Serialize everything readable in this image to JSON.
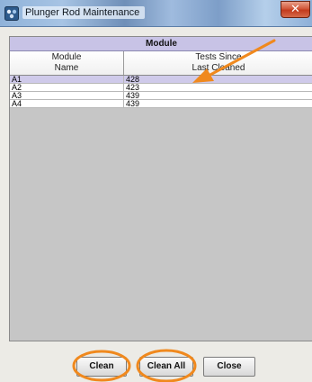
{
  "window": {
    "title": "Plunger Rod Maintenance",
    "close_glyph": "✕",
    "icon": "app-icon"
  },
  "table": {
    "group_header": "Module",
    "columns": [
      {
        "line1": "Module",
        "line2": "Name"
      },
      {
        "line1": "Tests Since",
        "line2": "Last Cleaned"
      }
    ],
    "rows": [
      {
        "name": "A1",
        "tests": "428",
        "selected": true
      },
      {
        "name": "A2",
        "tests": "423",
        "selected": false
      },
      {
        "name": "A3",
        "tests": "439",
        "selected": false
      },
      {
        "name": "A4",
        "tests": "439",
        "selected": false
      }
    ]
  },
  "buttons": {
    "clean": "Clean",
    "clean_all": "Clean All",
    "close": "Close"
  },
  "annotations": {
    "color": "#f0891e",
    "arrow": "arrow-pointing-to-first-row",
    "circles": [
      "clean-button",
      "clean-all-button"
    ]
  }
}
